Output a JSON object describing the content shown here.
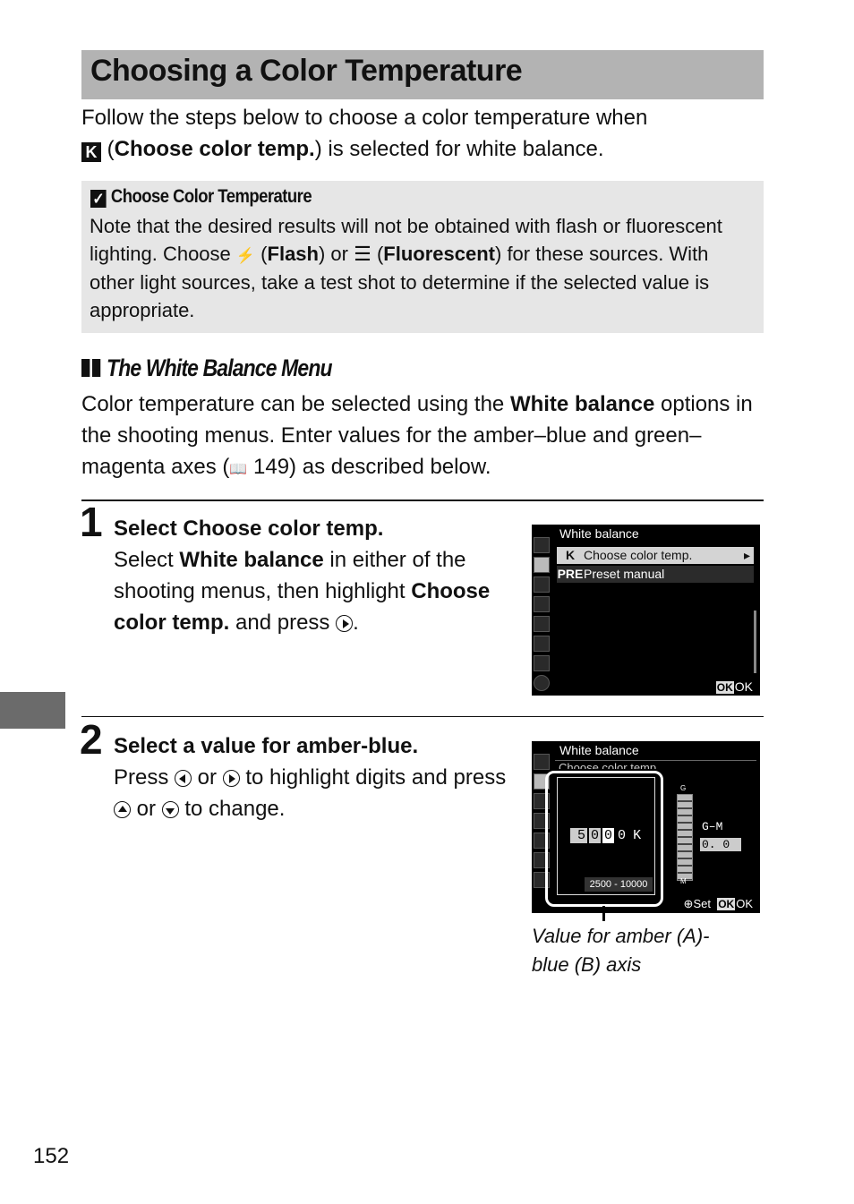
{
  "title": "Choosing a Color Temperature",
  "intro": {
    "line1": "Follow the steps below to choose a color temperature when",
    "icon": "K",
    "paren_open": " (",
    "bold": "Choose color temp.",
    "rest": ") is selected for white balance."
  },
  "note": {
    "icon": "✓",
    "heading": "Choose Color Temperature",
    "t1": "Note that the desired results will not be obtained with flash or fluorescent lighting.  Choose ",
    "flash_icon": "⚡",
    "t2": " (",
    "flash": "Flash",
    "t3": ") or ",
    "fluor_icon": "☰",
    "t4": " (",
    "fluorescent": "Fluorescent",
    "t5": ") for these sources.  With other light sources, take a test shot to determine if the selected value is appropriate."
  },
  "subsection": {
    "heading": "The White Balance Menu",
    "t1": "Color temperature can be selected using the ",
    "bold": "White balance",
    "t2": " options in the shooting menus. Enter values for the amber–blue and green–magenta axes (",
    "book_icon": "📖",
    "t3": " 149) as described below."
  },
  "step1": {
    "number": "1",
    "head_pre": "Select ",
    "head_bold": "Choose color temp.",
    "t1": "Select ",
    "b1": "White balance",
    "t2": " in either of the shooting menus, then highlight ",
    "b2": "Choose color temp.",
    "t3": " and press ",
    "t4": "."
  },
  "step2": {
    "number": "2",
    "head": "Select a value for amber-blue.",
    "t1": "Press ",
    "t2": " or ",
    "t3": " to highlight digits and press ",
    "t4": " or ",
    "t5": " to change."
  },
  "screen1": {
    "title": "White balance",
    "items": [
      {
        "icon": "K",
        "label": "Choose color temp."
      },
      {
        "icon": "PRE",
        "label": "Preset manual"
      }
    ],
    "ok_box": "OK",
    "ok_label": "OK"
  },
  "screen2": {
    "title": "White balance",
    "subtitle": "Choose color temp.",
    "digits": [
      "5",
      "0",
      "0",
      "0"
    ],
    "unit": "K",
    "range": "2500 - 10000",
    "gm_label": "G–M",
    "gm_value": "0. 0",
    "g_label": "G",
    "m_label": "M",
    "set_label": "Set",
    "ok_box": "OK",
    "ok_label": "OK"
  },
  "caption": "Value for amber (A)-blue (B) axis",
  "page_number": "152"
}
